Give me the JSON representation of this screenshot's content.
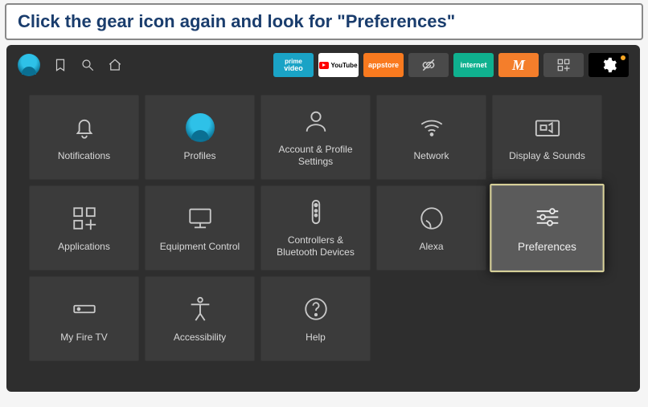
{
  "instruction": "Click the gear icon again and look for \"Preferences\"",
  "topbar": {
    "apps": {
      "prime_l1": "prime",
      "prime_l2": "video",
      "youtube": "YouTube",
      "appstore": "appstore",
      "internet": "internet",
      "m": "M"
    }
  },
  "tiles": {
    "notifications": "Notifications",
    "profiles": "Profiles",
    "account": "Account & Profile Settings",
    "network": "Network",
    "display": "Display & Sounds",
    "applications": "Applications",
    "equipment": "Equipment Control",
    "controllers": "Controllers & Bluetooth Devices",
    "alexa": "Alexa",
    "preferences": "Preferences",
    "myfiretv": "My Fire TV",
    "accessibility": "Accessibility",
    "help": "Help"
  }
}
